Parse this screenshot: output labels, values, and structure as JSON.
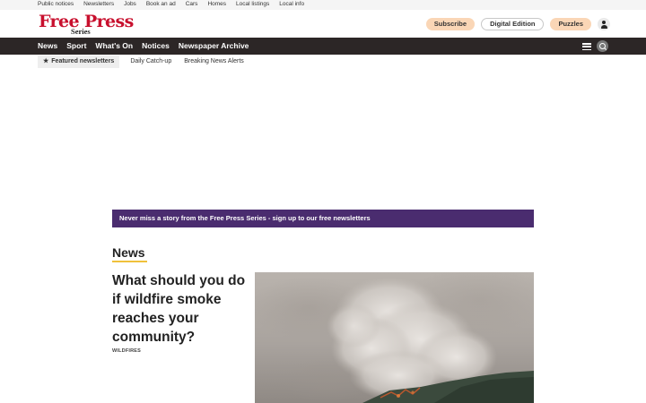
{
  "utility_nav": {
    "links": [
      "Public notices",
      "Newsletters",
      "Jobs",
      "Book an ad",
      "Cars",
      "Homes",
      "Local listings",
      "Local info"
    ]
  },
  "masthead": {
    "logo_main": "Free Press",
    "logo_sub": "Series",
    "subscribe_label": "Subscribe",
    "digital_edition_label": "Digital Edition",
    "puzzles_label": "Puzzles",
    "account_icon": "user-icon"
  },
  "main_nav": {
    "items": [
      "News",
      "Sport",
      "What's On",
      "Notices",
      "Newspaper Archive"
    ],
    "menu_icon": "hamburger-menu-icon",
    "search_icon": "search-icon"
  },
  "newsletter_nav": {
    "featured_icon": "star-icon",
    "featured_label": "Featured newsletters",
    "links": [
      "Daily Catch-up",
      "Breaking News Alerts"
    ]
  },
  "banner": {
    "text": "Never miss a story from the Free Press Series - sign up to our free newsletters"
  },
  "news_section": {
    "title": "News",
    "lead_story": {
      "headline": "What should you do if wildfire smoke reaches your community?",
      "tag": "WILDFIRES",
      "image_subject": "wildfire smoke rising over hillside"
    }
  },
  "colors": {
    "brand_red": "#c8102e",
    "nav_dark": "#2c2626",
    "banner_purple": "#4a2c6f",
    "pill_peach": "#fad6b6",
    "section_underline": "#f0c13b"
  }
}
